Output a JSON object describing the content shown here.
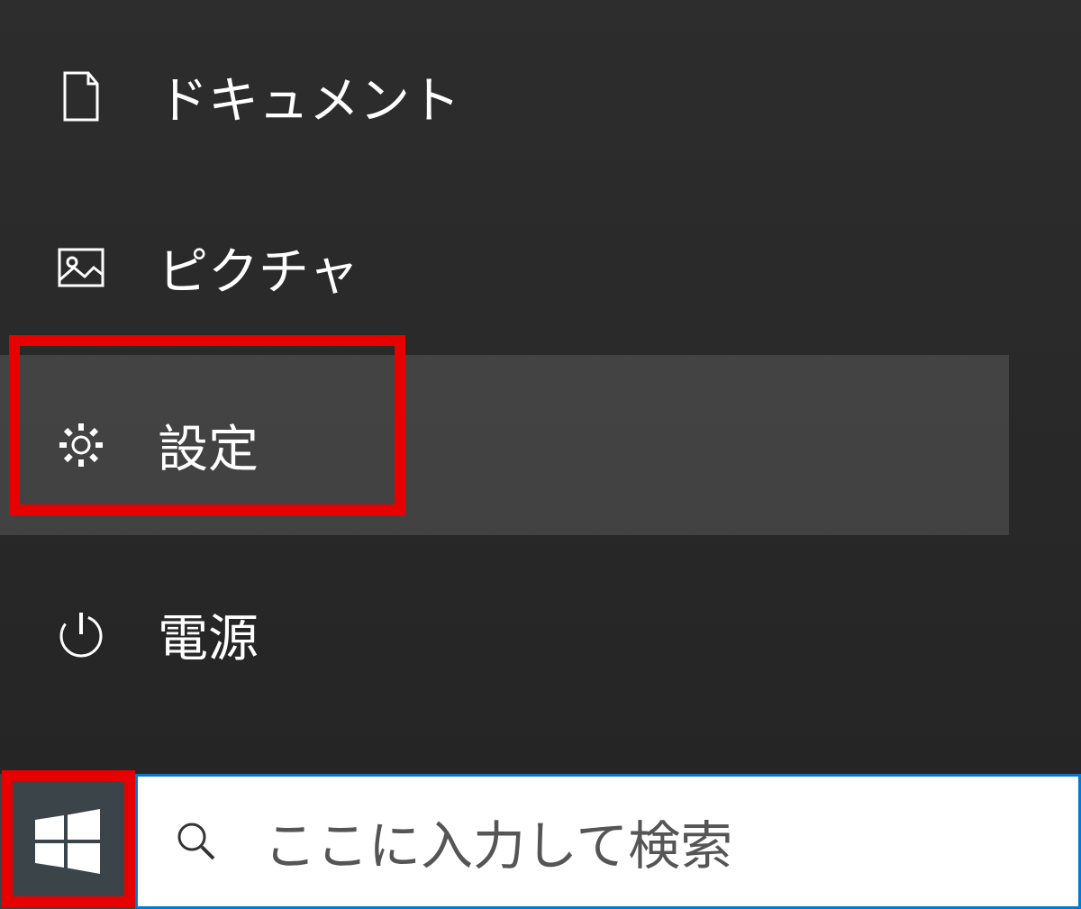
{
  "start_menu": {
    "items": [
      {
        "id": "documents",
        "label": "ドキュメント",
        "icon": "document-icon"
      },
      {
        "id": "pictures",
        "label": "ピクチャ",
        "icon": "picture-icon"
      },
      {
        "id": "settings",
        "label": "設定",
        "icon": "gear-icon"
      },
      {
        "id": "power",
        "label": "電源",
        "icon": "power-icon"
      }
    ]
  },
  "taskbar": {
    "search_placeholder": "ここに入力して検索"
  },
  "highlights": {
    "settings_highlighted": true,
    "start_button_highlighted": true
  },
  "colors": {
    "highlight_red": "#e60000",
    "search_border_blue": "#0078d4",
    "menu_bg": "#2a2a2a"
  }
}
